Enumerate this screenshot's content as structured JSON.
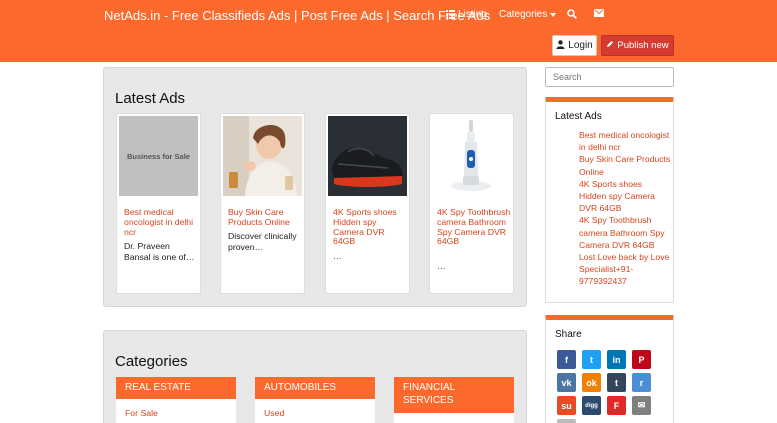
{
  "header": {
    "brand": "NetAds.in - Free Classifieds Ads | Post Free Ads | Search Free Ads",
    "listing": "Listing",
    "categories": "Categories",
    "login": "Login",
    "publish": "Publish new"
  },
  "latest_ads": {
    "title": "Latest Ads",
    "ads": [
      {
        "image_text": "Business for Sale",
        "title": "Best medical oncologist in delhi ncr",
        "desc": "Dr. Praveen Bansal is one of…"
      },
      {
        "title": "Buy Skin Care Products Online",
        "desc": "Discover clinically proven…"
      },
      {
        "title": "4K Sports shoes Hidden spy Camera DVR 64GB",
        "desc": "…"
      },
      {
        "title": "4K Spy Toothbrush camera Bathroom Spy Camera DVR 64GB",
        "desc": "…"
      }
    ]
  },
  "categories_section": {
    "title": "Categories",
    "items": [
      {
        "name": "REAL ESTATE",
        "sub": "For Sale"
      },
      {
        "name": "AUTOMOBILES",
        "sub": "Used"
      },
      {
        "name": "FINANCIAL SERVICES",
        "sub": ""
      }
    ]
  },
  "sidebar": {
    "search_placeholder": "Search",
    "latest_title": "Latest Ads",
    "latest": [
      "Best medical oncologist in delhi ncr",
      "Buy Skin Care Products Online",
      "4K Sports shoes Hidden spy Camera DVR 64GB",
      "4K Spy Toothbrush camera Bathroom Spy Camera DVR 64GB",
      "Lost Love back by Love Specialist+91-9779392437"
    ],
    "share_title": "Share",
    "share_buttons": [
      {
        "name": "facebook",
        "glyph": "f",
        "color": "#3b5998"
      },
      {
        "name": "twitter",
        "glyph": "t",
        "color": "#1da1f2"
      },
      {
        "name": "linkedin",
        "glyph": "in",
        "color": "#0077b5"
      },
      {
        "name": "pinterest",
        "glyph": "P",
        "color": "#bd081c"
      },
      {
        "name": "vk",
        "glyph": "vk",
        "color": "#4c75a3"
      },
      {
        "name": "odnoklassniki",
        "glyph": "ok",
        "color": "#ee8208"
      },
      {
        "name": "tumblr",
        "glyph": "t",
        "color": "#35465c"
      },
      {
        "name": "reddit",
        "glyph": "r",
        "color": "#4a8fd6"
      },
      {
        "name": "stumbleupon",
        "glyph": "su",
        "color": "#eb4924"
      },
      {
        "name": "digg",
        "glyph": "digg",
        "color": "#2a4a6e"
      },
      {
        "name": "flipboard",
        "glyph": "F",
        "color": "#e12828"
      },
      {
        "name": "email",
        "glyph": "✉",
        "color": "#7f7f7f"
      },
      {
        "name": "print",
        "glyph": "⎙",
        "color": "#bbbbbb"
      }
    ]
  },
  "colors": {
    "accent": "#fb6a2c",
    "link": "#d6451d",
    "publish": "#d63b31"
  }
}
